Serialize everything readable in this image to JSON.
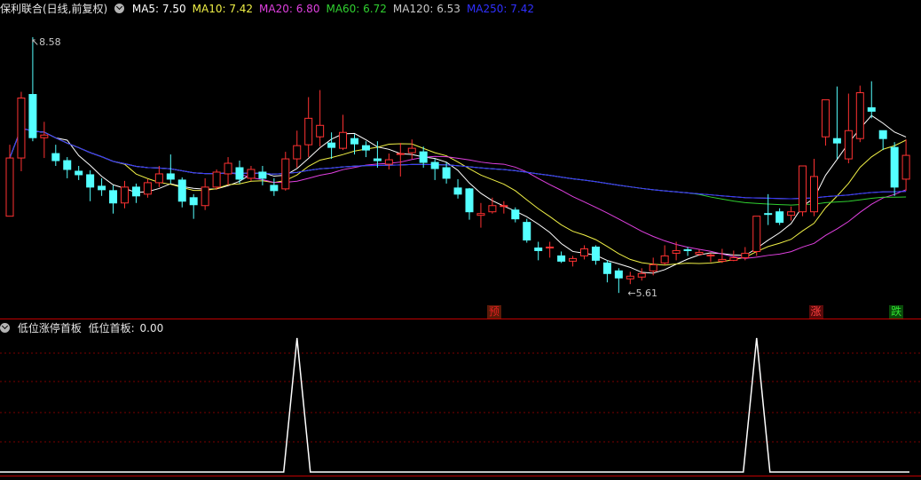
{
  "header": {
    "title": "保利联合(日线,前复权)",
    "ma": [
      {
        "label": "MA5:",
        "value": "7.50",
        "color": "#ffffff"
      },
      {
        "label": "MA10:",
        "value": "7.42",
        "color": "#f0f046"
      },
      {
        "label": "MA20:",
        "value": "6.80",
        "color": "#e040e0"
      },
      {
        "label": "MA60:",
        "value": "6.72",
        "color": "#30d030"
      },
      {
        "label": "MA120:",
        "value": "6.53",
        "color": "#c8c8c8"
      },
      {
        "label": "MA250:",
        "value": "7.42",
        "color": "#3030ff"
      }
    ]
  },
  "annotations": {
    "high": "8.58",
    "low": "5.61"
  },
  "markers": [
    {
      "text": "预",
      "color": "#e02020",
      "bg": "#5a1a08",
      "index": 42
    },
    {
      "text": "涨",
      "color": "#ff4040",
      "bg": "#5a0a0a",
      "index": 70
    },
    {
      "text": "跌",
      "color": "#30e030",
      "bg": "#0a4a0a",
      "index": 77
    }
  ],
  "indicator": {
    "title": "低位涨停首板",
    "label": "低位首板:",
    "value": "0.00",
    "spikes": [
      25,
      65
    ]
  },
  "colors": {
    "up": "#ff3232",
    "down": "#54ffff",
    "grid": "#7a0000",
    "border": "#c00000"
  },
  "chart_data": {
    "type": "candlestick",
    "ylim": [
      5.4,
      8.8
    ],
    "candles": [
      [
        6.55,
        7.21,
        7.36,
        6.55
      ],
      [
        7.21,
        7.89,
        7.96,
        7.06
      ],
      [
        7.93,
        7.44,
        8.58,
        7.4
      ],
      [
        7.44,
        7.47,
        7.62,
        7.21
      ],
      [
        7.26,
        7.18,
        7.36,
        7.12
      ],
      [
        7.18,
        7.08,
        7.22,
        6.98
      ],
      [
        7.06,
        7.02,
        7.12,
        6.96
      ],
      [
        7.02,
        6.88,
        7.07,
        6.72
      ],
      [
        6.89,
        6.85,
        6.98,
        6.78
      ],
      [
        6.84,
        6.7,
        6.9,
        6.58
      ],
      [
        6.7,
        6.88,
        6.95,
        6.64
      ],
      [
        6.88,
        6.78,
        6.92,
        6.7
      ],
      [
        6.8,
        6.93,
        6.97,
        6.76
      ],
      [
        6.93,
        7.03,
        7.12,
        6.88
      ],
      [
        7.03,
        6.97,
        7.25,
        6.92
      ],
      [
        6.96,
        6.72,
        6.99,
        6.65
      ],
      [
        6.76,
        6.68,
        6.8,
        6.52
      ],
      [
        6.67,
        6.88,
        6.98,
        6.62
      ],
      [
        6.88,
        7.05,
        7.08,
        6.85
      ],
      [
        7.03,
        7.15,
        7.22,
        6.9
      ],
      [
        7.1,
        6.97,
        7.18,
        6.92
      ],
      [
        6.98,
        7.08,
        7.12,
        6.95
      ],
      [
        7.05,
        6.98,
        7.12,
        6.9
      ],
      [
        6.9,
        6.84,
        6.98,
        6.78
      ],
      [
        6.86,
        7.2,
        7.28,
        6.84
      ],
      [
        7.2,
        7.35,
        7.52,
        7.1
      ],
      [
        7.36,
        7.66,
        7.9,
        7.22
      ],
      [
        7.45,
        7.58,
        7.98,
        7.34
      ],
      [
        7.38,
        7.33,
        7.5,
        7.2
      ],
      [
        7.32,
        7.5,
        7.7,
        7.3
      ],
      [
        7.43,
        7.37,
        7.48,
        7.25
      ],
      [
        7.35,
        7.3,
        7.4,
        7.22
      ],
      [
        7.2,
        7.18,
        7.4,
        7.1
      ],
      [
        7.14,
        7.19,
        7.26,
        7.08
      ],
      [
        7.25,
        7.26,
        7.38,
        7.0
      ],
      [
        7.27,
        7.32,
        7.42,
        7.2
      ],
      [
        7.28,
        7.16,
        7.34,
        7.1
      ],
      [
        7.16,
        7.09,
        7.2,
        6.96
      ],
      [
        7.1,
        6.98,
        7.16,
        6.92
      ],
      [
        6.87,
        6.8,
        6.97,
        6.75
      ],
      [
        6.86,
        6.6,
        6.87,
        6.51
      ],
      [
        6.56,
        6.58,
        6.7,
        6.42
      ],
      [
        6.6,
        6.67,
        6.76,
        6.58
      ],
      [
        6.66,
        6.67,
        6.72,
        6.58
      ],
      [
        6.62,
        6.52,
        6.65,
        6.48
      ],
      [
        6.48,
        6.28,
        6.52,
        6.25
      ],
      [
        6.19,
        6.16,
        6.26,
        6.05
      ],
      [
        6.19,
        6.2,
        6.26,
        6.08
      ],
      [
        6.1,
        6.04,
        6.15,
        6.02
      ],
      [
        6.04,
        6.07,
        6.1,
        5.98
      ],
      [
        6.1,
        6.18,
        6.22,
        6.06
      ],
      [
        6.2,
        6.05,
        6.22,
        6.0
      ],
      [
        6.02,
        5.9,
        6.05,
        5.8
      ],
      [
        5.93,
        5.85,
        5.96,
        5.68
      ],
      [
        5.84,
        5.87,
        5.92,
        5.78
      ],
      [
        5.86,
        5.9,
        5.96,
        5.82
      ],
      [
        5.93,
        6.0,
        6.08,
        5.88
      ],
      [
        6.02,
        6.1,
        6.22,
        6.0
      ],
      [
        6.13,
        6.16,
        6.26,
        6.05
      ],
      [
        6.17,
        6.16,
        6.2,
        6.1
      ],
      [
        6.12,
        6.14,
        6.17,
        6.1
      ],
      [
        6.1,
        6.11,
        6.13,
        6.03
      ],
      [
        6.04,
        6.06,
        6.18,
        6.02
      ],
      [
        6.05,
        6.08,
        6.16,
        6.04
      ],
      [
        6.08,
        6.13,
        6.2,
        6.05
      ],
      [
        6.15,
        6.55,
        6.55,
        6.1
      ],
      [
        6.58,
        6.57,
        6.8,
        6.45
      ],
      [
        6.6,
        6.48,
        6.64,
        6.45
      ],
      [
        6.56,
        6.6,
        6.66,
        6.5
      ],
      [
        6.6,
        7.12,
        7.12,
        6.55
      ],
      [
        6.6,
        7.0,
        7.2,
        6.55
      ],
      [
        7.45,
        7.87,
        7.87,
        7.35
      ],
      [
        7.43,
        7.38,
        8.02,
        7.2
      ],
      [
        7.2,
        7.52,
        7.94,
        7.15
      ],
      [
        7.43,
        7.95,
        8.03,
        7.39
      ],
      [
        7.78,
        7.74,
        8.08,
        7.66
      ],
      [
        7.52,
        7.43,
        7.52,
        7.3
      ],
      [
        7.33,
        6.88,
        7.39,
        6.78
      ],
      [
        6.97,
        7.24,
        7.42,
        6.84
      ]
    ]
  }
}
